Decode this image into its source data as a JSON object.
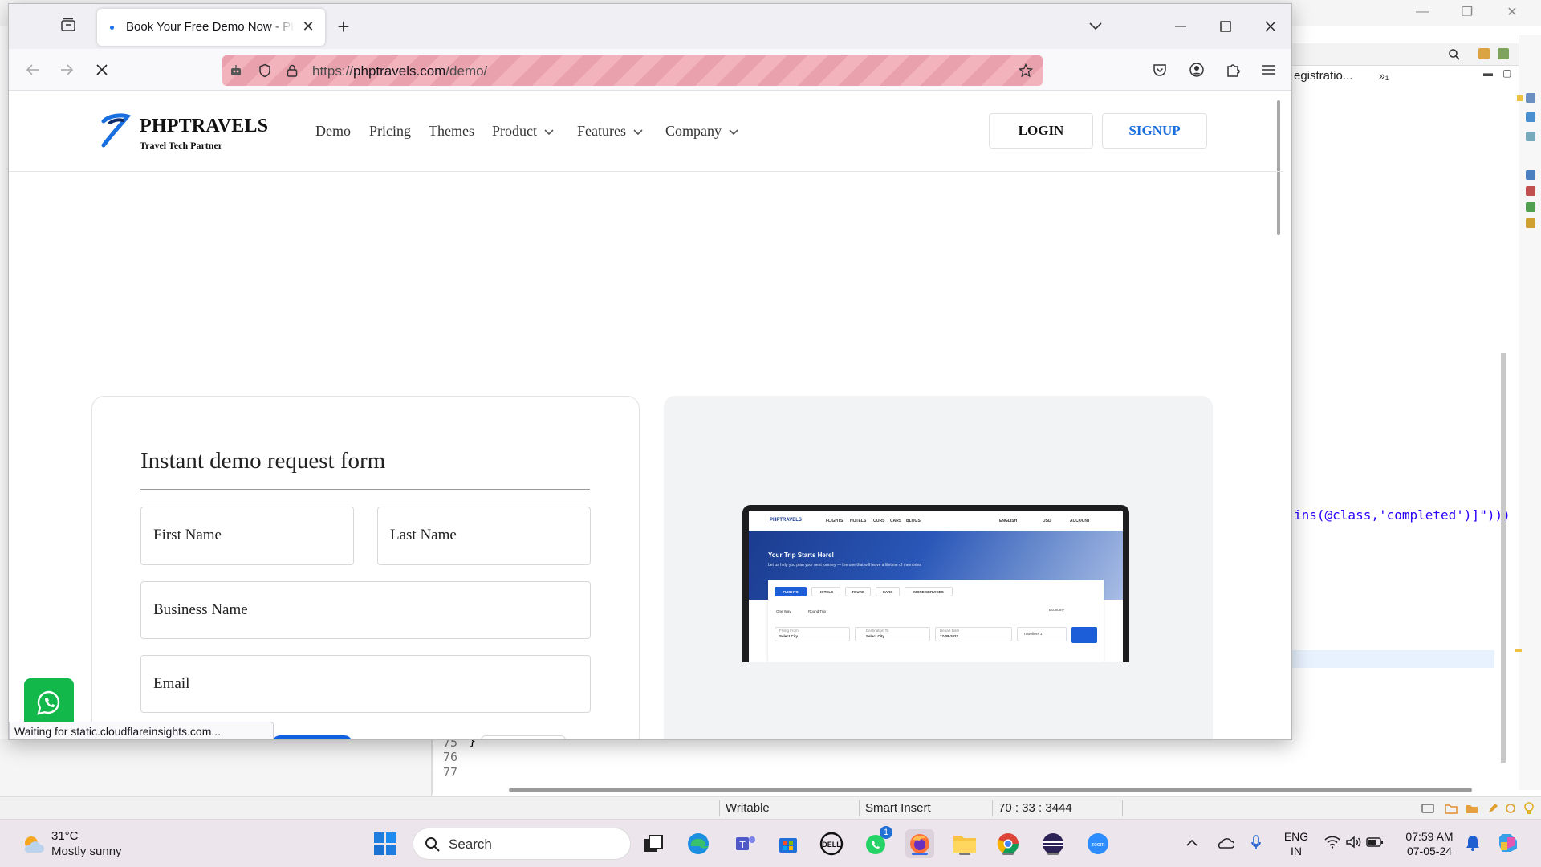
{
  "ide": {
    "tab_label": "egistratio...",
    "tab_overflow": "»₁",
    "code_fragment": "ins(@class,'completed')]\")))",
    "line_numbers": [
      "75",
      "76",
      "77"
    ],
    "brace": "}",
    "status": {
      "writable": "Writable",
      "insert_mode": "Smart Insert",
      "position": "70 : 33 : 3444"
    }
  },
  "browser": {
    "tab_title": "Book Your Free Demo Now - PHPTRAVELS",
    "url_prefix": "https://",
    "url_domain": "phptravels.com",
    "url_path": "/demo/",
    "status_tip": "Waiting for static.cloudflareinsights.com..."
  },
  "site": {
    "logo_name": "PHPTRAVELS",
    "logo_tagline": "Travel Tech Partner",
    "menu": [
      {
        "label": "Demo",
        "has_dropdown": false
      },
      {
        "label": "Pricing",
        "has_dropdown": false
      },
      {
        "label": "Themes",
        "has_dropdown": false
      },
      {
        "label": "Product",
        "has_dropdown": true
      },
      {
        "label": "Features",
        "has_dropdown": true
      },
      {
        "label": "Company",
        "has_dropdown": true
      }
    ],
    "login_label": "LOGIN",
    "signup_label": "SIGNUP",
    "accent_color": "#1a6fe0"
  },
  "form": {
    "title": "Instant demo request form",
    "first_name": "First Name",
    "last_name": "Last Name",
    "business_name": "Business Name",
    "email": "Email"
  },
  "preview": {
    "logo": "PHPTRAVELS",
    "nav": [
      "FLIGHTS",
      "HOTELS",
      "TOURS",
      "CARS",
      "BLOGS"
    ],
    "lang": "ENGLISH",
    "currency": "USD",
    "account": "ACCOUNT",
    "hero_title": "Your Trip Starts Here!",
    "hero_sub": "Let us help you plan your next journey — the one that will leave a lifetime of memories",
    "tabs": [
      "FLIGHTS",
      "HOTELS",
      "TOURS",
      "CARS",
      "MORE SERVICES"
    ],
    "trip_types": [
      "One Way",
      "Round Trip"
    ],
    "cabin": "Economy",
    "from_label": "Flying From",
    "from_value": "Select City",
    "to_label": "Destination To",
    "to_value": "Select City",
    "date_label": "Depart Date",
    "date_value": "17-08-2023",
    "travellers": "Travellers 1"
  },
  "taskbar": {
    "temperature": "31°C",
    "weather": "Mostly sunny",
    "search_placeholder": "Search",
    "whatsapp_badge": "1",
    "lang_top": "ENG",
    "lang_bottom": "IN",
    "time": "07:59 AM",
    "date": "07-05-24"
  }
}
